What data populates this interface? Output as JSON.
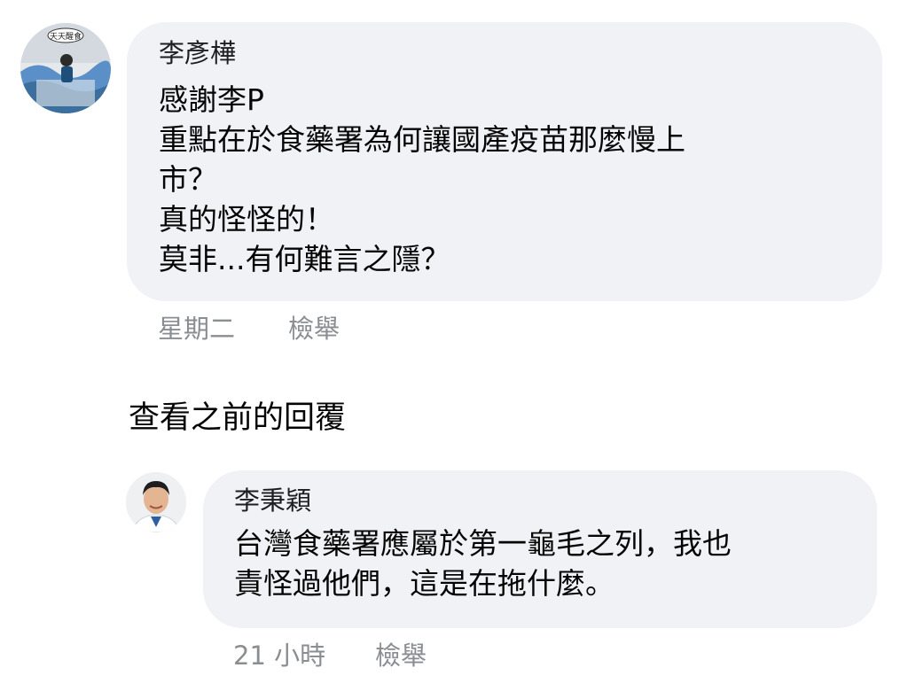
{
  "comment": {
    "author": "李彥樺",
    "lines": [
      "感謝李P",
      "重點在於食藥署為何讓國產疫苗那麼慢上",
      "市？",
      "真的怪怪的！",
      "莫非...有何難言之隱？"
    ],
    "time": "星期二",
    "report_label": "檢舉",
    "avatar_text": "天天醒食"
  },
  "view_previous_label": "查看之前的回覆",
  "reply": {
    "author": "李秉穎",
    "lines": [
      "台灣食藥署應屬於第一龜毛之列，我也",
      "責怪過他們，這是在拖什麼。"
    ],
    "time": "21 小時",
    "report_label": "檢舉"
  },
  "colors": {
    "bubble": "#f0f2f5",
    "meta": "#8a8d91",
    "text": "#050505"
  }
}
